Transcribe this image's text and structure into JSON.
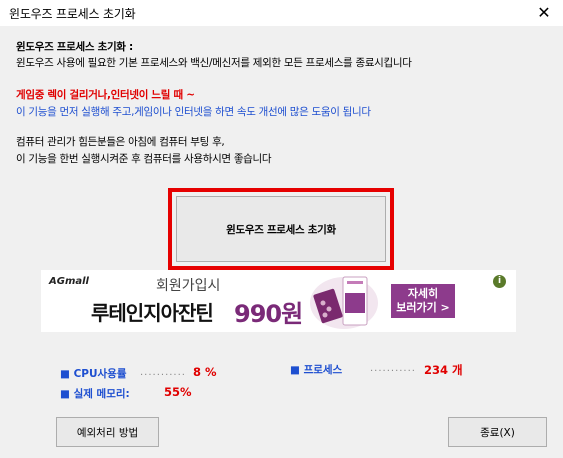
{
  "window": {
    "title": "윈도우즈 프로세스 초기화",
    "close_glyph": "✕"
  },
  "desc": {
    "heading": "윈도우즈 프로세스 초기화 :",
    "line1": "윈도우즈 사용에 필요한 기본 프로세스와 백신/메신저를 제외한 모든 프로세스를 종료시킵니다",
    "warn": "게임중 렉이 걸리거나,인터넷이 느릴 때 ~",
    "info": "이 기능을 먼저 실행해 주고,게임이나 인터넷을 하면 속도 개선에 많은 도움이 됩니다",
    "tip1": "컴퓨터 관리가 힘든분들은 아침에 컴퓨터 부팅 후,",
    "tip2": "이 기능을 한번 실행시켜준 후 컴퓨터를 사용하시면 좋습니다"
  },
  "main_button": {
    "label": "윈도우즈 프로세스 초기화",
    "highlight_color": "#e60000"
  },
  "ad": {
    "brand": "AGmall",
    "subtitle": "회원가입시",
    "headline": "루테인지아잔틴",
    "price": "990원",
    "cta_line1": "자세히",
    "cta_line2": "보러가기 >",
    "info_glyph": "i"
  },
  "stats": {
    "cpu_label": "■ CPU사용률",
    "cpu_value": "8 %",
    "mem_label": "■ 실제 메모리:",
    "mem_value": "55%",
    "proc_label": "■ 프로세스",
    "proc_value": "234 개",
    "dots": "..........."
  },
  "footer": {
    "exception_label": "예외처리 방법",
    "exit_label": "종료(X)"
  }
}
